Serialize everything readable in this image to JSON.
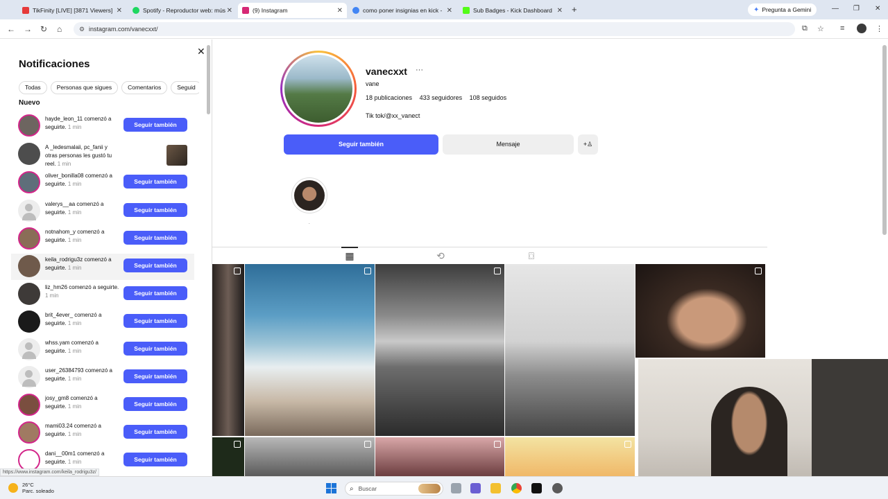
{
  "browser": {
    "tabs": [
      {
        "label": "TikFinity [LIVE] [3871 Viewers]",
        "color": "#e63a3a"
      },
      {
        "label": "Spotify - Reproductor web: mús",
        "color": "#1ed760"
      },
      {
        "label": "(9) Instagram",
        "color": "#d62976"
      },
      {
        "label": "como poner insignias en kick -",
        "color": "#4285f4"
      },
      {
        "label": "Sub Badges - Kick Dashboard",
        "color": "#53fc18"
      }
    ],
    "gemini_label": "Pregunta a Gemini",
    "url": "instagram.com/vanecxxt/",
    "status_url": "https://www.instagram.com/keila_rodrigu3z/"
  },
  "notifications": {
    "title": "Notificaciones",
    "filters": [
      "Todas",
      "Personas que sigues",
      "Comentarios",
      "Seguid"
    ],
    "section_new": "Nuevo",
    "follow_back_label": "Seguir también",
    "items": [
      {
        "user": "hayde_leon_11",
        "text": " comenzó a seguirte.",
        "time": "1 min",
        "button": true,
        "ring": true,
        "avatar": "#6d6560"
      },
      {
        "user": "A _ledesmalaii, pc_fanii",
        "text": " y otras personas les gustó tu reel.",
        "time": "1 min",
        "button": false,
        "ring": false,
        "avatar": "#4d4d4d"
      },
      {
        "user": "oliver_bonilla08",
        "text": " comenzó a seguirte.",
        "time": "1 min",
        "button": true,
        "ring": true,
        "avatar": "#5f6e7a"
      },
      {
        "user": "valerys__aa",
        "text": " comenzó a seguirte.",
        "time": "1 min",
        "button": true,
        "ring": false,
        "avatar": "gray"
      },
      {
        "user": "notnahom_y",
        "text": " comenzó a seguirte.",
        "time": "1 min",
        "button": true,
        "ring": true,
        "avatar": "#8a6d57"
      },
      {
        "user": "keila_rodrigu3z",
        "text": " comenzó a seguirte.",
        "time": "1 min",
        "button": true,
        "ring": false,
        "avatar": "#6f5a4b"
      },
      {
        "user": "liz_hm26",
        "text": " comenzó a seguirte.",
        "time": "1 min",
        "button": true,
        "ring": false,
        "avatar": "#3e3a38"
      },
      {
        "user": "brit_4ever_",
        "text": " comenzó a seguirte.",
        "time": "1 min",
        "button": true,
        "ring": false,
        "avatar": "#1a1a1a"
      },
      {
        "user": "whss.yam",
        "text": " comenzó a seguirte.",
        "time": "1 min",
        "button": true,
        "ring": false,
        "avatar": "gray"
      },
      {
        "user": "user_26384793",
        "text": " comenzó a seguirte.",
        "time": "1 min",
        "button": true,
        "ring": false,
        "avatar": "gray"
      },
      {
        "user": "josy_gm8",
        "text": " comenzó a seguirte.",
        "time": "1 min",
        "button": true,
        "ring": true,
        "avatar": "#7a4e3f"
      },
      {
        "user": "mami03.24",
        "text": " comenzó a seguirte.",
        "time": "1 min",
        "button": true,
        "ring": true,
        "avatar": "#a07a62"
      },
      {
        "user": "dani__00m1",
        "text": " comenzó a seguirte.",
        "time": "1 min",
        "button": true,
        "ring": true,
        "avatar": "#ffffff"
      }
    ]
  },
  "profile": {
    "username": "vanecxxt",
    "more_icon": "···",
    "name": "vane",
    "posts": "18 publicaciones",
    "followers": "433 seguidores",
    "following": "108 seguidos",
    "bio": "Tik tok/@xx_vanect",
    "follow_label": "Seguir también",
    "message_label": "Mensaje",
    "highlight_label": "."
  },
  "taskbar": {
    "temperature": "26°C",
    "weather": "Parc. soleado",
    "search_placeholder": "Buscar"
  },
  "colors": {
    "accent": "#4a5df9",
    "story_ring": "#d3268a"
  }
}
